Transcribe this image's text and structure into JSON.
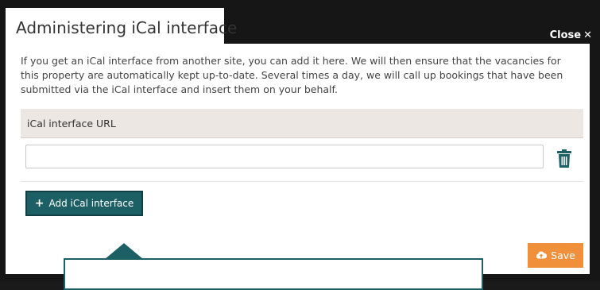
{
  "dialog": {
    "title": "Administering iCal interface",
    "close_label": "Close",
    "description": "If you get an iCal interface from another site, you can add it here. We will then ensure that the vacancies for this property are automatically kept up-to-date. Several times a day, we will call up bookings that have been submitted via the iCal interface and insert them on your behalf.",
    "url_section_label": "iCal interface URL",
    "url_value": "",
    "add_button_label": "Add iCal interface",
    "save_button_label": "Save"
  },
  "icons": {
    "close": "close-icon",
    "delete": "trash-icon",
    "add": "plus-icon",
    "save": "cloud-upload-icon"
  },
  "colors": {
    "primary": "#1c6065",
    "save": "#f0903a",
    "label_bar": "#ece7e3"
  }
}
